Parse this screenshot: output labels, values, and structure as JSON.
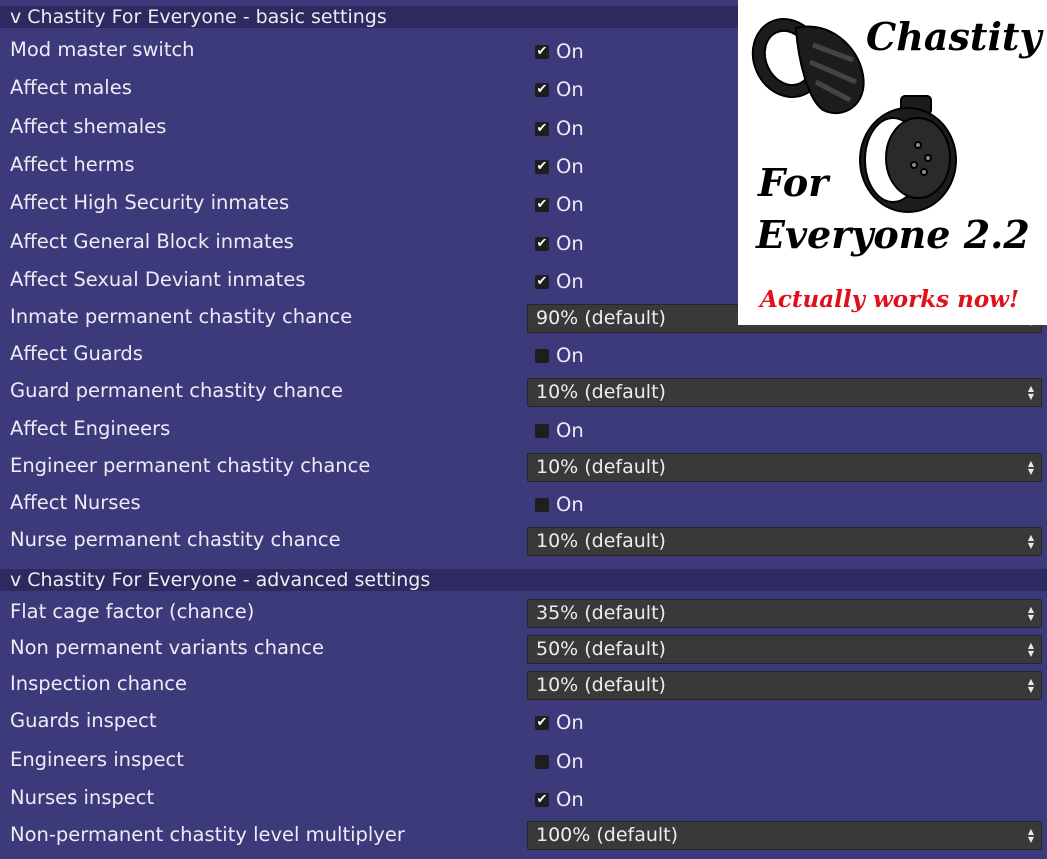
{
  "sections": {
    "basic": {
      "header": "v Chastity For Everyone - basic settings"
    },
    "advanced": {
      "header": "v Chastity For Everyone - advanced settings"
    }
  },
  "basic_settings": [
    {
      "label": "Mod master switch",
      "type": "checkbox",
      "checked": true,
      "value_text": "On"
    },
    {
      "label": "Affect males",
      "type": "checkbox",
      "checked": true,
      "value_text": "On"
    },
    {
      "label": "Affect shemales",
      "type": "checkbox",
      "checked": true,
      "value_text": "On"
    },
    {
      "label": "Affect herms",
      "type": "checkbox",
      "checked": true,
      "value_text": "On"
    },
    {
      "label": "Affect High Security inmates",
      "type": "checkbox",
      "checked": true,
      "value_text": "On"
    },
    {
      "label": "Affect General Block inmates",
      "type": "checkbox",
      "checked": true,
      "value_text": "On"
    },
    {
      "label": "Affect Sexual Deviant inmates",
      "type": "checkbox",
      "checked": true,
      "value_text": "On"
    },
    {
      "label": "Inmate permanent chastity chance",
      "type": "select",
      "value_text": "90% (default)"
    },
    {
      "label": "Affect Guards",
      "type": "checkbox",
      "checked": false,
      "value_text": "On"
    },
    {
      "label": "Guard permanent chastity chance",
      "type": "select",
      "value_text": "10% (default)"
    },
    {
      "label": "Affect Engineers",
      "type": "checkbox",
      "checked": false,
      "value_text": "On"
    },
    {
      "label": "Engineer permanent chastity chance",
      "type": "select",
      "value_text": "10% (default)"
    },
    {
      "label": "Affect Nurses",
      "type": "checkbox",
      "checked": false,
      "value_text": "On"
    },
    {
      "label": "Nurse permanent chastity chance",
      "type": "select",
      "value_text": "10% (default)"
    }
  ],
  "advanced_settings": [
    {
      "label": "Flat cage factor (chance)",
      "type": "select",
      "value_text": "35% (default)"
    },
    {
      "label": "Non permanent variants chance",
      "type": "select",
      "value_text": "50% (default)"
    },
    {
      "label": "Inspection chance",
      "type": "select",
      "value_text": "10% (default)"
    },
    {
      "label": "Guards inspect",
      "type": "checkbox",
      "checked": true,
      "value_text": "On"
    },
    {
      "label": "Engineers inspect",
      "type": "checkbox",
      "checked": false,
      "value_text": "On"
    },
    {
      "label": "Nurses inspect",
      "type": "checkbox",
      "checked": true,
      "value_text": "On"
    },
    {
      "label": "Non-permanent chastity level multiplyer",
      "type": "select",
      "value_text": "100% (default)"
    }
  ],
  "logo": {
    "line1": "Chastity",
    "line2": "For",
    "line3": "Everyone 2.2",
    "tagline": "Actually works now!",
    "tagline_color": "#e0101a"
  },
  "icons": {
    "check": "check-icon",
    "select_arrows": "updown-arrows-icon"
  },
  "colors": {
    "background": "#3d3a7c",
    "header": "#2c2a5e",
    "select_bg": "#393939",
    "checkbox_bg": "#1e1e1e"
  }
}
